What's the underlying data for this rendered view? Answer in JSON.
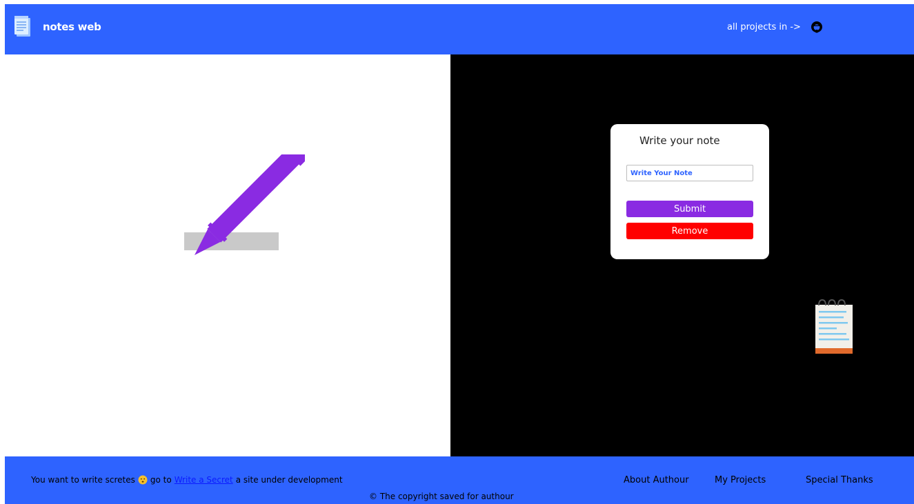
{
  "header": {
    "title": "notes web",
    "projects_text": "all projects in ->",
    "logo_icon": "notepad-icon",
    "github_icon": "github-icon",
    "background": "#2e63ff"
  },
  "card": {
    "title": "Write your note",
    "input_placeholder": "Write Your Note",
    "input_value": "",
    "submit_label": "Submit",
    "remove_label": "Remove",
    "submit_color": "#8a2be2",
    "remove_color": "#ff0000"
  },
  "illustrations": {
    "left": "pencil-writing-illustration",
    "right": "notepad-illustration"
  },
  "footer": {
    "msg_prefix": "You want to write scretes",
    "msg_goto": "go to",
    "link_text": "Write a Secret",
    "msg_suffix": "a site under development",
    "links": [
      "About Authour",
      "My Projects",
      "Special Thanks"
    ],
    "copyright": "© The copyright saved for authour"
  }
}
